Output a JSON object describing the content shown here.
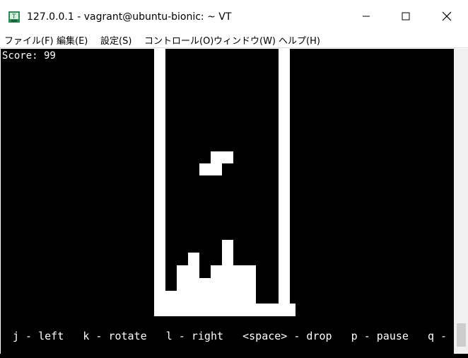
{
  "window": {
    "title": "127.0.0.1 - vagrant@ubuntu-bionic: ~ VT",
    "app_icon": "terminal-icon",
    "controls": [
      "minimize-icon",
      "maximize-icon",
      "close-icon"
    ]
  },
  "menu": {
    "items": [
      "ファイル(F)",
      "編集(E)",
      "設定(S)",
      "コントロール(O)",
      "ウィンドウ(W)",
      "ヘルプ(H)"
    ]
  },
  "terminal": {
    "background": "#000000",
    "foreground": "#ffffff",
    "score_text": "Score: 99",
    "help_text": "j - left   k - rotate   l - right   <space> - drop   p - pause   q - quit"
  }
}
